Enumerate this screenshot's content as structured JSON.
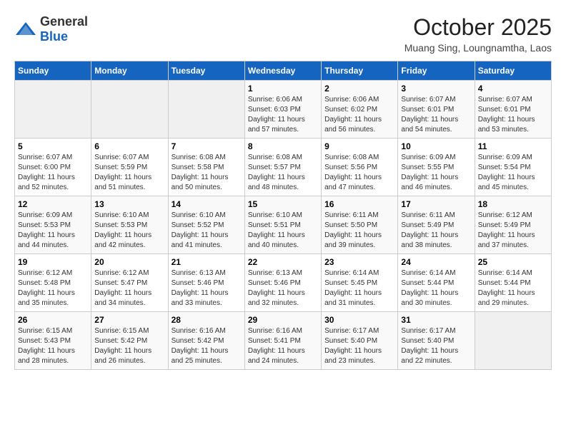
{
  "header": {
    "logo": {
      "general": "General",
      "blue": "Blue"
    },
    "title": "October 2025",
    "subtitle": "Muang Sing, Loungnamtha, Laos"
  },
  "weekdays": [
    "Sunday",
    "Monday",
    "Tuesday",
    "Wednesday",
    "Thursday",
    "Friday",
    "Saturday"
  ],
  "weeks": [
    [
      {
        "day": "",
        "detail": ""
      },
      {
        "day": "",
        "detail": ""
      },
      {
        "day": "",
        "detail": ""
      },
      {
        "day": "1",
        "detail": "Sunrise: 6:06 AM\nSunset: 6:03 PM\nDaylight: 11 hours\nand 57 minutes."
      },
      {
        "day": "2",
        "detail": "Sunrise: 6:06 AM\nSunset: 6:02 PM\nDaylight: 11 hours\nand 56 minutes."
      },
      {
        "day": "3",
        "detail": "Sunrise: 6:07 AM\nSunset: 6:01 PM\nDaylight: 11 hours\nand 54 minutes."
      },
      {
        "day": "4",
        "detail": "Sunrise: 6:07 AM\nSunset: 6:01 PM\nDaylight: 11 hours\nand 53 minutes."
      }
    ],
    [
      {
        "day": "5",
        "detail": "Sunrise: 6:07 AM\nSunset: 6:00 PM\nDaylight: 11 hours\nand 52 minutes."
      },
      {
        "day": "6",
        "detail": "Sunrise: 6:07 AM\nSunset: 5:59 PM\nDaylight: 11 hours\nand 51 minutes."
      },
      {
        "day": "7",
        "detail": "Sunrise: 6:08 AM\nSunset: 5:58 PM\nDaylight: 11 hours\nand 50 minutes."
      },
      {
        "day": "8",
        "detail": "Sunrise: 6:08 AM\nSunset: 5:57 PM\nDaylight: 11 hours\nand 48 minutes."
      },
      {
        "day": "9",
        "detail": "Sunrise: 6:08 AM\nSunset: 5:56 PM\nDaylight: 11 hours\nand 47 minutes."
      },
      {
        "day": "10",
        "detail": "Sunrise: 6:09 AM\nSunset: 5:55 PM\nDaylight: 11 hours\nand 46 minutes."
      },
      {
        "day": "11",
        "detail": "Sunrise: 6:09 AM\nSunset: 5:54 PM\nDaylight: 11 hours\nand 45 minutes."
      }
    ],
    [
      {
        "day": "12",
        "detail": "Sunrise: 6:09 AM\nSunset: 5:53 PM\nDaylight: 11 hours\nand 44 minutes."
      },
      {
        "day": "13",
        "detail": "Sunrise: 6:10 AM\nSunset: 5:53 PM\nDaylight: 11 hours\nand 42 minutes."
      },
      {
        "day": "14",
        "detail": "Sunrise: 6:10 AM\nSunset: 5:52 PM\nDaylight: 11 hours\nand 41 minutes."
      },
      {
        "day": "15",
        "detail": "Sunrise: 6:10 AM\nSunset: 5:51 PM\nDaylight: 11 hours\nand 40 minutes."
      },
      {
        "day": "16",
        "detail": "Sunrise: 6:11 AM\nSunset: 5:50 PM\nDaylight: 11 hours\nand 39 minutes."
      },
      {
        "day": "17",
        "detail": "Sunrise: 6:11 AM\nSunset: 5:49 PM\nDaylight: 11 hours\nand 38 minutes."
      },
      {
        "day": "18",
        "detail": "Sunrise: 6:12 AM\nSunset: 5:49 PM\nDaylight: 11 hours\nand 37 minutes."
      }
    ],
    [
      {
        "day": "19",
        "detail": "Sunrise: 6:12 AM\nSunset: 5:48 PM\nDaylight: 11 hours\nand 35 minutes."
      },
      {
        "day": "20",
        "detail": "Sunrise: 6:12 AM\nSunset: 5:47 PM\nDaylight: 11 hours\nand 34 minutes."
      },
      {
        "day": "21",
        "detail": "Sunrise: 6:13 AM\nSunset: 5:46 PM\nDaylight: 11 hours\nand 33 minutes."
      },
      {
        "day": "22",
        "detail": "Sunrise: 6:13 AM\nSunset: 5:46 PM\nDaylight: 11 hours\nand 32 minutes."
      },
      {
        "day": "23",
        "detail": "Sunrise: 6:14 AM\nSunset: 5:45 PM\nDaylight: 11 hours\nand 31 minutes."
      },
      {
        "day": "24",
        "detail": "Sunrise: 6:14 AM\nSunset: 5:44 PM\nDaylight: 11 hours\nand 30 minutes."
      },
      {
        "day": "25",
        "detail": "Sunrise: 6:14 AM\nSunset: 5:44 PM\nDaylight: 11 hours\nand 29 minutes."
      }
    ],
    [
      {
        "day": "26",
        "detail": "Sunrise: 6:15 AM\nSunset: 5:43 PM\nDaylight: 11 hours\nand 28 minutes."
      },
      {
        "day": "27",
        "detail": "Sunrise: 6:15 AM\nSunset: 5:42 PM\nDaylight: 11 hours\nand 26 minutes."
      },
      {
        "day": "28",
        "detail": "Sunrise: 6:16 AM\nSunset: 5:42 PM\nDaylight: 11 hours\nand 25 minutes."
      },
      {
        "day": "29",
        "detail": "Sunrise: 6:16 AM\nSunset: 5:41 PM\nDaylight: 11 hours\nand 24 minutes."
      },
      {
        "day": "30",
        "detail": "Sunrise: 6:17 AM\nSunset: 5:40 PM\nDaylight: 11 hours\nand 23 minutes."
      },
      {
        "day": "31",
        "detail": "Sunrise: 6:17 AM\nSunset: 5:40 PM\nDaylight: 11 hours\nand 22 minutes."
      },
      {
        "day": "",
        "detail": ""
      }
    ]
  ]
}
